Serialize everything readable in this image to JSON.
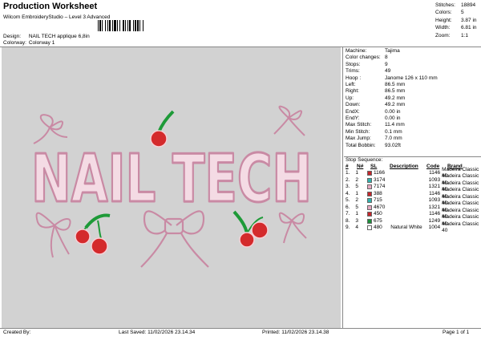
{
  "header": {
    "title": "Production Worksheet",
    "subtitle": "Wilcom EmbroideryStudio – Level 3 Advanced",
    "design_label": "Design:",
    "design_value": "NAIL TECH applique 6,8in",
    "colorway_label": "Colorway:",
    "colorway_value": "Colorway 1"
  },
  "stats": [
    {
      "k": "Stitches:",
      "v": "18894"
    },
    {
      "k": "Colors:",
      "v": "5"
    },
    {
      "k": "Height:",
      "v": "3.87 in"
    },
    {
      "k": "Width:",
      "v": "6.81 in"
    },
    {
      "k": "Zoom:",
      "v": "1:1"
    }
  ],
  "design_text": "NAIL TECH",
  "properties": [
    {
      "k": "Machine:",
      "v": "Tajima"
    },
    {
      "k": "Color changes:",
      "v": "8"
    },
    {
      "k": "Stops:",
      "v": "9"
    },
    {
      "k": "Trims:",
      "v": "49"
    },
    {
      "k": "Hoop :",
      "v": "Janome 126 x 110 mm"
    },
    {
      "k": "Left:",
      "v": "86.5 mm"
    },
    {
      "k": "Right:",
      "v": "86.5 mm"
    },
    {
      "k": "Up:",
      "v": "49.2 mm"
    },
    {
      "k": "Down:",
      "v": "49.2 mm"
    },
    {
      "k": "EndX:",
      "v": "0.00 in"
    },
    {
      "k": "EndY:",
      "v": "0.00 in"
    },
    {
      "k": "Max Stitch:",
      "v": "11.4 mm"
    },
    {
      "k": "Min Stitch:",
      "v": "0.1 mm"
    },
    {
      "k": "Max Jump:",
      "v": "7.0 mm"
    },
    {
      "k": "Total Bobbin:",
      "v": "93.02ft"
    }
  ],
  "stop_sequence": {
    "label": "Stop Sequence:",
    "headers": [
      "#",
      "N#",
      "SL",
      "Description",
      "Code",
      "Brand"
    ],
    "rows": [
      {
        "n": "1.",
        "nn": "1",
        "color": "#c4262b",
        "sl": "1166",
        "desc": "",
        "code": "1146",
        "brand": "Madeira Classic 40"
      },
      {
        "n": "2.",
        "nn": "2",
        "color": "#32b3ae",
        "sl": "3174",
        "desc": "",
        "code": "1093",
        "brand": "Madeira Classic 40"
      },
      {
        "n": "3.",
        "nn": "5",
        "color": "#e6a8c1",
        "sl": "7174",
        "desc": "",
        "code": "1321",
        "brand": "Madeira Classic 40"
      },
      {
        "n": "4.",
        "nn": "1",
        "color": "#c4262b",
        "sl": "388",
        "desc": "",
        "code": "1146",
        "brand": "Madeira Classic 40"
      },
      {
        "n": "5.",
        "nn": "2",
        "color": "#32b3ae",
        "sl": "715",
        "desc": "",
        "code": "1093",
        "brand": "Madeira Classic 40"
      },
      {
        "n": "6.",
        "nn": "5",
        "color": "#e6a8c1",
        "sl": "4670",
        "desc": "",
        "code": "1321",
        "brand": "Madeira Classic 40"
      },
      {
        "n": "7.",
        "nn": "1",
        "color": "#c4262b",
        "sl": "450",
        "desc": "",
        "code": "1146",
        "brand": "Madeira Classic 40"
      },
      {
        "n": "8.",
        "nn": "3",
        "color": "#1d8f3a",
        "sl": "675",
        "desc": "",
        "code": "1249",
        "brand": "Madeira Classic 40"
      },
      {
        "n": "9.",
        "nn": "4",
        "color": "#ffffff",
        "sl": "480",
        "desc": "Natural White",
        "code": "1004",
        "brand": "Madeira Classic 40"
      }
    ]
  },
  "footer": {
    "created_by": "Created By:",
    "last_saved": "Last Saved: 11/02/2026 23.14.34",
    "printed": "Printed: 11/02/2026 23.14.38",
    "page": "Page 1 of 1"
  },
  "colors": {
    "pink_outline": "#c98aa4",
    "pink_fill": "#f4dbe4",
    "cherry_red": "#d42a2c",
    "stem_green": "#1e9a38",
    "canvas_bg": "#d2d2d2"
  }
}
